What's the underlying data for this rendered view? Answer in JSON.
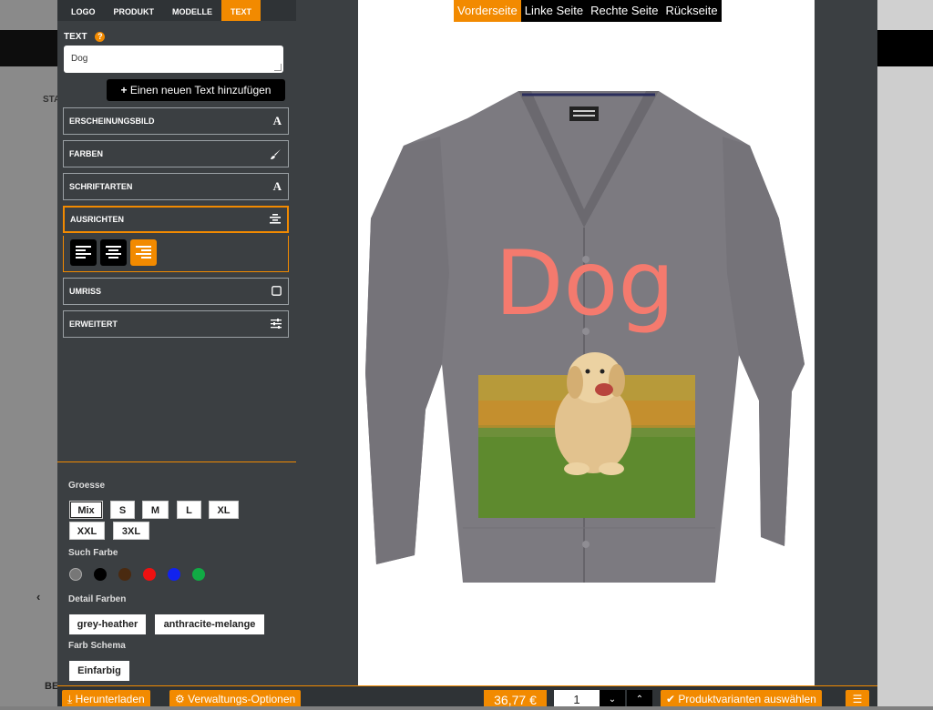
{
  "panel": {
    "tabs": [
      "LOGO",
      "PRODUKT",
      "MODELLE",
      "TEXT"
    ],
    "active_tab": "TEXT",
    "text_label": "TEXT",
    "text_value": "Dog",
    "add_text_label": "Einen neuen Text hinzufügen",
    "accordion": {
      "appearance": "ERSCHEINUNGSBILD",
      "colors": "FARBEN",
      "fonts": "SCHRIFTARTEN",
      "align": "AUSRICHTEN",
      "outline": "UMRISS",
      "advanced": "ERWEITERT"
    },
    "active_alignment": "right",
    "size_label": "Groesse",
    "sizes": [
      "Mix",
      "S",
      "M",
      "L",
      "XL",
      "XXL",
      "3XL"
    ],
    "selected_size": "Mix",
    "color_search_label": "Such Farbe",
    "swatches": [
      "#777777",
      "#000000",
      "#4a2a10",
      "#ee1111",
      "#1122ee",
      "#11aa44"
    ],
    "detail_colors_label": "Detail Farben",
    "detail_colors": [
      "grey-heather",
      "anthracite-melange"
    ],
    "scheme_label": "Farb Schema",
    "scheme": "Einfarbig"
  },
  "stage": {
    "side_tabs": [
      "Vorderseite",
      "Linke Seite",
      "Rechte Seite",
      "Rückseite"
    ],
    "active_side": "Vorderseite",
    "design_text": "Dog",
    "design_text_color": "#f47a6e",
    "garment_color": "#7c7a80"
  },
  "bottom": {
    "download": "Herunterladen",
    "admin": "Verwaltungs-Optionen",
    "price": "36,77 €",
    "quantity": "1",
    "variants": "Produktvarianten auswählen"
  },
  "background": {
    "left_sta": "STA",
    "left_be": "BE"
  },
  "colors": {
    "accent": "#f28a00",
    "panel": "#3b3f42"
  }
}
